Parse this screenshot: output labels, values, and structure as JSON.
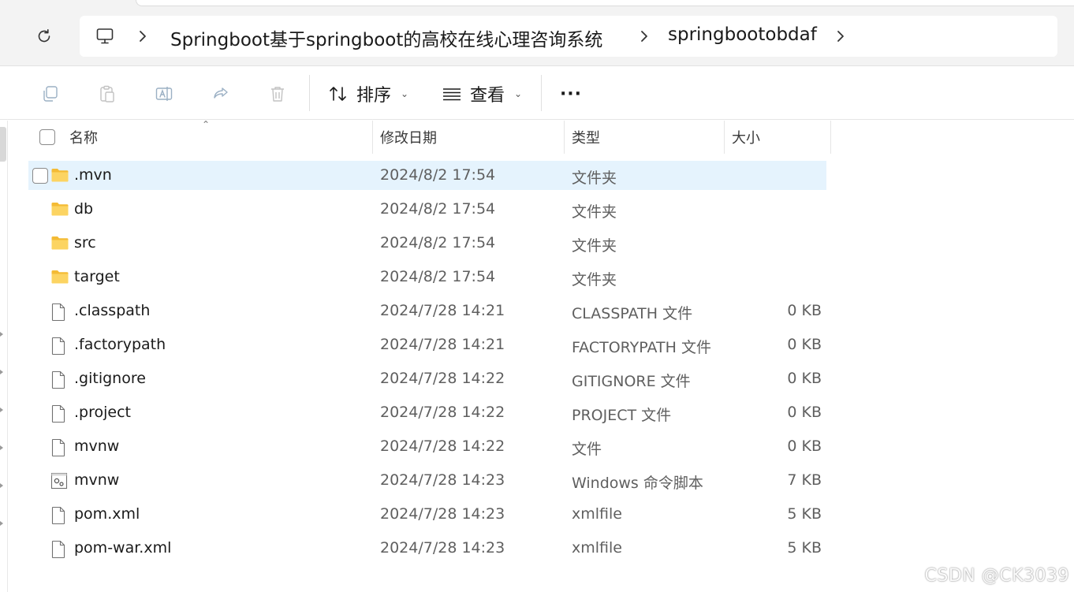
{
  "breadcrumb": {
    "items": [
      "Springboot基于springboot的高校在线心理咨询系统",
      "springbootobdaf"
    ]
  },
  "toolbar": {
    "sort_label": "排序",
    "view_label": "查看",
    "more_label": "···"
  },
  "columns": {
    "name": "名称",
    "date": "修改日期",
    "type": "类型",
    "size": "大小"
  },
  "files": [
    {
      "name": ".mvn",
      "date": "2024/8/2 17:54",
      "type": "文件夹",
      "size": "",
      "icon": "folder-icon",
      "selected": true
    },
    {
      "name": "db",
      "date": "2024/8/2 17:54",
      "type": "文件夹",
      "size": "",
      "icon": "folder-icon"
    },
    {
      "name": "src",
      "date": "2024/8/2 17:54",
      "type": "文件夹",
      "size": "",
      "icon": "folder-icon"
    },
    {
      "name": "target",
      "date": "2024/8/2 17:54",
      "type": "文件夹",
      "size": "",
      "icon": "folder-icon"
    },
    {
      "name": ".classpath",
      "date": "2024/7/28 14:21",
      "type": "CLASSPATH 文件",
      "size": "0 KB",
      "icon": "file-icon"
    },
    {
      "name": ".factorypath",
      "date": "2024/7/28 14:21",
      "type": "FACTORYPATH 文件",
      "size": "0 KB",
      "icon": "file-icon"
    },
    {
      "name": ".gitignore",
      "date": "2024/7/28 14:22",
      "type": "GITIGNORE 文件",
      "size": "0 KB",
      "icon": "file-icon"
    },
    {
      "name": ".project",
      "date": "2024/7/28 14:22",
      "type": "PROJECT 文件",
      "size": "0 KB",
      "icon": "file-icon"
    },
    {
      "name": "mvnw",
      "date": "2024/7/28 14:22",
      "type": "文件",
      "size": "0 KB",
      "icon": "file-icon"
    },
    {
      "name": "mvnw",
      "date": "2024/7/28 14:23",
      "type": "Windows 命令脚本",
      "size": "7 KB",
      "icon": "script-file-icon"
    },
    {
      "name": "pom.xml",
      "date": "2024/7/28 14:23",
      "type": "xmlfile",
      "size": "5 KB",
      "icon": "file-icon"
    },
    {
      "name": "pom-war.xml",
      "date": "2024/7/28 14:23",
      "type": "xmlfile",
      "size": "5 KB",
      "icon": "file-icon"
    }
  ],
  "watermark": "CSDN @CK3039",
  "colors": {
    "selection": "#e5f3fd",
    "folder": "#f7c948",
    "chrome": "#f3f3f3"
  }
}
